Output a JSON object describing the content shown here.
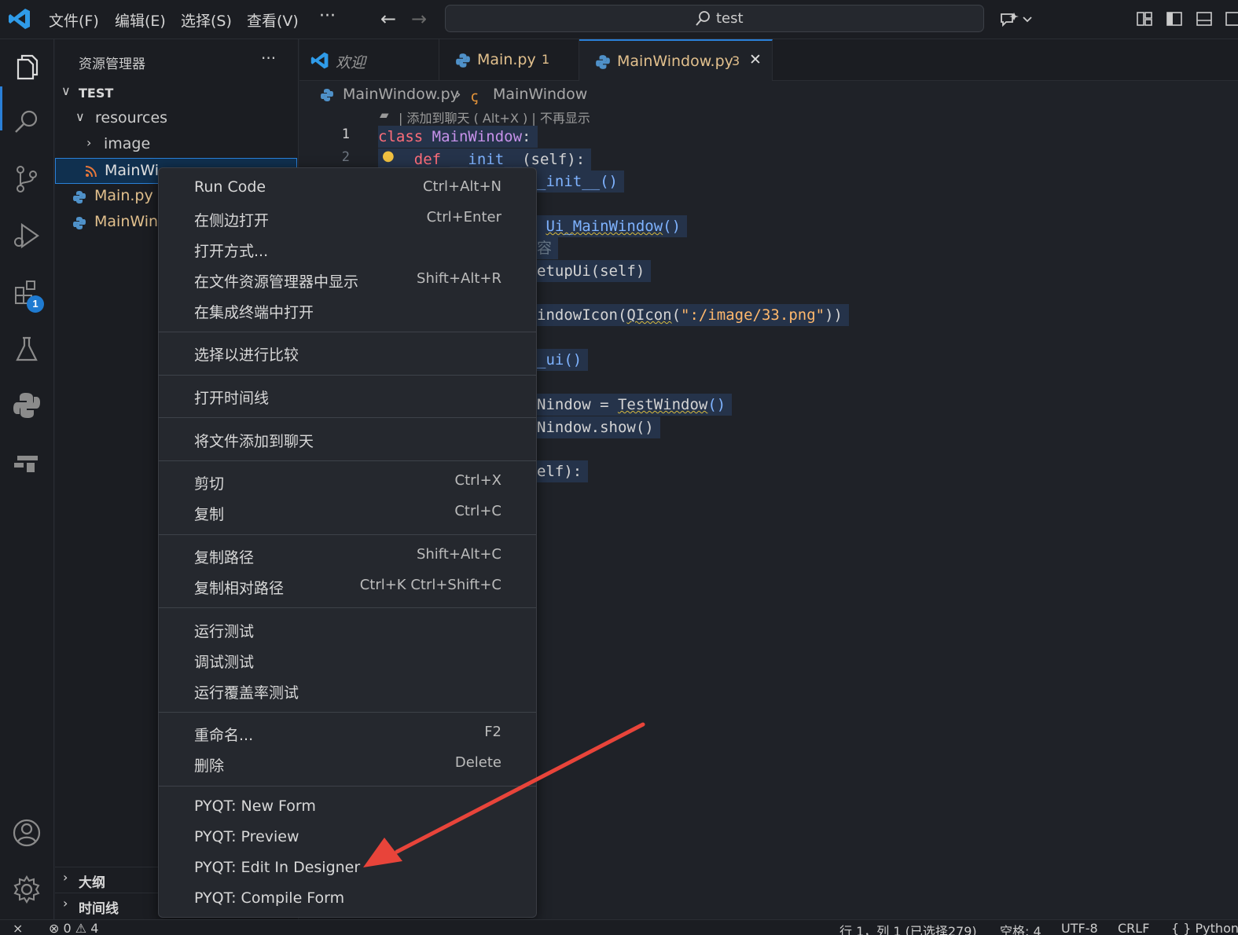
{
  "titlebar": {
    "menus": [
      "文件(F)",
      "编辑(E)",
      "选择(S)",
      "查看(V)"
    ],
    "more": "···",
    "search_text": "test"
  },
  "activitybar": {
    "extensions_badge": "1"
  },
  "sidebar": {
    "title": "资源管理器",
    "more": "···",
    "root": "TEST",
    "items": [
      {
        "label": "resources"
      },
      {
        "label": "image"
      },
      {
        "label": "MainWi"
      },
      {
        "label": "Main.py"
      },
      {
        "label": "MainWinc"
      }
    ],
    "outline": "大纲",
    "timeline": "时间线"
  },
  "tabs": [
    {
      "label": "欢迎",
      "badge": ""
    },
    {
      "label": "Main.py",
      "badge": "1"
    },
    {
      "label": "MainWindow.py",
      "badge": "3",
      "close": "✕"
    }
  ],
  "editor": {
    "breadcrumb": [
      "MainWindow.py",
      "MainWindow"
    ],
    "codelens": "| 添加到聊天 ( Alt+X ) | 不再显示",
    "line_numbers": [
      "1",
      "2"
    ],
    "code": {
      "l1_kw": "class",
      "l1_cls": "MainWindow",
      "l1_rest": ":",
      "l2_kw": "def",
      "l2_fn": "__init__",
      "l2_rest": "(self):",
      "l3": "_init__()",
      "l5_fn": "Ui_MainWindow",
      "l5_rest": "()",
      "l6_cmt": "容",
      "l7": "etupUi(self)",
      "l9_a": "indowIcon(",
      "l9_fn": "QIcon",
      "l9_b": "(",
      "l9_str": "\":/image/33.png\"",
      "l9_c": "))",
      "l11": "_ui()",
      "l13_a": "Nindow = ",
      "l13_fn": "TestWindow",
      "l13_b": "()",
      "l14": "Nindow.show()",
      "l16": "elf):"
    }
  },
  "context_menu": {
    "items": [
      {
        "label": "Run Code",
        "key": "Ctrl+Alt+N"
      },
      {
        "label": "在侧边打开",
        "key": "Ctrl+Enter"
      },
      {
        "label": "打开方式...",
        "key": ""
      },
      {
        "label": "在文件资源管理器中显示",
        "key": "Shift+Alt+R"
      },
      {
        "label": "在集成终端中打开",
        "key": ""
      },
      {
        "label": "选择以进行比较",
        "key": ""
      },
      {
        "label": "打开时间线",
        "key": ""
      },
      {
        "label": "将文件添加到聊天",
        "key": ""
      },
      {
        "label": "剪切",
        "key": "Ctrl+X"
      },
      {
        "label": "复制",
        "key": "Ctrl+C"
      },
      {
        "label": "复制路径",
        "key": "Shift+Alt+C"
      },
      {
        "label": "复制相对路径",
        "key": "Ctrl+K Ctrl+Shift+C"
      },
      {
        "label": "运行测试",
        "key": ""
      },
      {
        "label": "调试测试",
        "key": ""
      },
      {
        "label": "运行覆盖率测试",
        "key": ""
      },
      {
        "label": "重命名...",
        "key": "F2"
      },
      {
        "label": "删除",
        "key": "Delete"
      },
      {
        "label": "PYQT: New Form",
        "key": ""
      },
      {
        "label": "PYQT: Preview",
        "key": ""
      },
      {
        "label": "PYQT: Edit In Designer",
        "key": ""
      },
      {
        "label": "PYQT: Compile Form",
        "key": ""
      }
    ]
  },
  "statusbar": {
    "problems": "⊗ 0 ⚠ 4",
    "position": "行 1，列 1 (已选择279)",
    "spaces": "空格: 4",
    "encoding": "UTF-8",
    "eol": "CRLF",
    "language": "{ } Python"
  },
  "colors": {
    "accent": "#2a80d8",
    "arrow": "#e8443a",
    "modified_tab": "#e2c08d"
  }
}
